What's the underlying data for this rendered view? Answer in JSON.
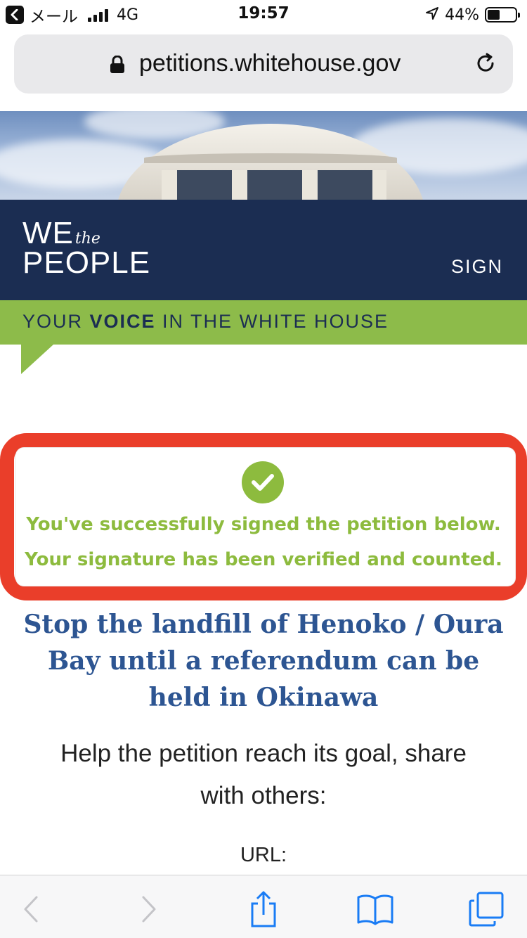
{
  "status_bar": {
    "back_app": "メール",
    "network": "4G",
    "time": "19:57",
    "battery_percent": "44%",
    "battery_level": 0.44,
    "icons": [
      "back-arrow-icon",
      "signal-icon",
      "location-arrow-icon",
      "battery-icon"
    ]
  },
  "address_bar": {
    "url": "petitions.whitehouse.gov",
    "icons": [
      "lock-icon",
      "reload-icon"
    ]
  },
  "header": {
    "logo_we": "WE",
    "logo_the": "the",
    "logo_people": "PEOPLE",
    "sign_link": "SIGN",
    "colors": {
      "navy": "#1b2d52",
      "green": "#8dbb4a"
    }
  },
  "tagline": {
    "before": "YOUR ",
    "emphasis": "VOICE",
    "after": " IN THE WHITE HOUSE"
  },
  "success": {
    "line1": "You've successfully signed the petition below.",
    "line2": "Your signature has been verified and counted.",
    "icon": "check-circle-icon",
    "highlight_color": "#ea3e2a"
  },
  "petition": {
    "title": "Stop the landfill of Henoko / Oura Bay until a referendum can be held in Okinawa",
    "share_prompt": "Help the petition reach its goal, share with others:",
    "url_label": "URL:"
  },
  "toolbar": {
    "icons": [
      "back-icon",
      "forward-icon",
      "share-icon",
      "bookmarks-icon",
      "tabs-icon"
    ]
  }
}
